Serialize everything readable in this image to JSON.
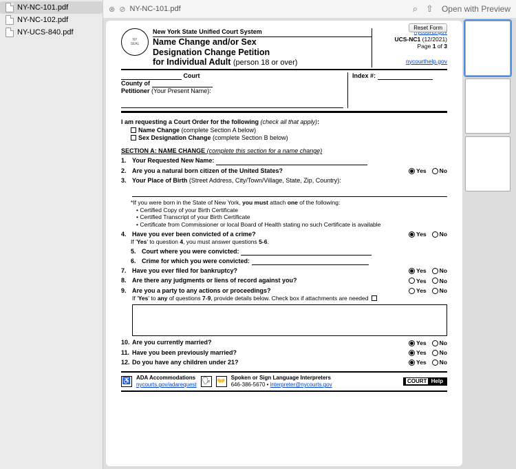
{
  "sidebar": {
    "files": [
      {
        "name": "NY-NC-101.pdf",
        "selected": true
      },
      {
        "name": "NY-NC-102.pdf",
        "selected": false
      },
      {
        "name": "NY-UCS-840.pdf",
        "selected": false
      }
    ]
  },
  "toolbar": {
    "title": "NY-NC-101.pdf",
    "open_label": "Open with Preview"
  },
  "reset_button": "Reset Form",
  "header": {
    "system": "New York State Unified Court System",
    "title_l1": "Name Change and/or Sex",
    "title_l2": "Designation Change Petition",
    "title_l3a": "for Individual Adult ",
    "title_l3b": "(person 18 or over)",
    "link_top": "nycourts.gov",
    "form_code": "UCS-NC1",
    "form_date": " (12/2021)",
    "page_label": "Page ",
    "page_num": "1",
    "page_of": " of ",
    "page_total": "3",
    "link_help": "nycourthelp.gov"
  },
  "case": {
    "court_label": " Court",
    "county_label": "County of ",
    "petitioner_label": "Petitioner",
    "petitioner_note": " (Your Present Name):",
    "index_label": "Index #: "
  },
  "intro": {
    "text_a": "I am requesting a Court Order for the following ",
    "text_b": "(check all that apply)",
    "text_c": ":",
    "opt1_a": "Name Change ",
    "opt1_b": "(complete Section A below)",
    "opt2_a": "Sex Designation Change ",
    "opt2_b": "(complete Section B below)"
  },
  "sectionA": {
    "head_a": "SECTION A",
    "head_b": ": NAME CHANGE ",
    "head_c": "(complete this section for a name change)"
  },
  "q1": {
    "num": "1.",
    "label": "Your Requested New Name: "
  },
  "q2": {
    "num": "2.",
    "label": "Are you a natural born citizen of the United States?",
    "yes_sel": true,
    "no_sel": false
  },
  "q3": {
    "num": "3.",
    "label_a": "Your Place of Birth ",
    "label_b": "(Street Address, City/Town/Village, State, Zip, Country):"
  },
  "note": {
    "l1a": "*If you were born in the State of New York, ",
    "l1b": "you must",
    "l1c": " attach ",
    "l1d": "one",
    "l1e": " of the following:",
    "b1": "• Certified Copy of your Birth Certificate",
    "b2": "• Certified Transcript of your Birth Certificate",
    "b3": "• Certificate from Commissioner or local Board of Health stating no such Certificate is available"
  },
  "q4": {
    "num": "4.",
    "label": "Have you ever been convicted of a crime?",
    "yes_sel": true,
    "no_sel": false,
    "sub_a": "If '",
    "sub_b": "Yes",
    "sub_c": "' to question ",
    "sub_d": "4",
    "sub_e": ", you must answer questions ",
    "sub_f": "5-6",
    "sub_g": "."
  },
  "q5": {
    "num": "5.",
    "label": "Court where you were convicted: "
  },
  "q6": {
    "num": "6.",
    "label": "Crime for which you were convicted: "
  },
  "q7": {
    "num": "7.",
    "label": "Have you ever filed for bankruptcy?",
    "yes_sel": true,
    "no_sel": false
  },
  "q8": {
    "num": "8.",
    "label": "Are there any judgments or liens of record against you?",
    "yes_sel": false,
    "no_sel": false,
    "neutral": true
  },
  "q9": {
    "num": "9.",
    "label": "Are you a party to any actions or proceedings?",
    "yes_sel": false,
    "no_sel": false,
    "neutral": true,
    "sub_a": "If '",
    "sub_b": "Yes",
    "sub_c": "' to ",
    "sub_d": "any",
    "sub_e": " of questions ",
    "sub_f": "7-9",
    "sub_g": ", provide details below.   Check box if attachments are needed "
  },
  "q10": {
    "num": "10.",
    "label": "Are you currently married?",
    "yes_sel": true,
    "no_sel": false
  },
  "q11": {
    "num": "11.",
    "label": "Have you been previously married?",
    "yes_sel": true,
    "no_sel": false
  },
  "q12": {
    "num": "12.",
    "label": "Do you have any children under 21?",
    "yes_sel": true,
    "no_sel": false
  },
  "yn": {
    "yes": "Yes",
    "no": "No"
  },
  "footer": {
    "ada_label": "ADA Accommodations",
    "ada_link": "nycourts.gov/adarequest",
    "interp_label": "Spoken or Sign Language Interpreters",
    "interp_phone": "646-386-5670 • ",
    "interp_link": "interpreter@nycourts.gov",
    "courthelp_a": "COURT",
    "courthelp_b": "Help"
  }
}
